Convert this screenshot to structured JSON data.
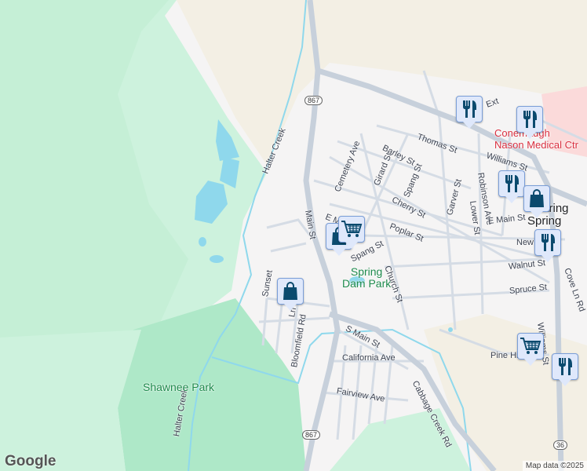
{
  "map": {
    "streets": [
      "Main St",
      "E Main St",
      "Poplar St",
      "Spang St",
      "Church St",
      "Cemetery Ave",
      "Girard St",
      "Spang St",
      "Barley St",
      "Thomas St",
      "Cherry St",
      "Garver St",
      "Lower St",
      "Robinson Ave",
      "Williams St",
      "E Main St",
      "New St",
      "Walnut St",
      "Spruce St",
      "Williams St",
      "Cove Ln Rd",
      "S Main St",
      "California Ave",
      "Fairview Ave",
      "Bloomfield Rd",
      "Cabbage Creek Rd",
      "Pine Hill St",
      "Halter Creek",
      "Halter Creek",
      "Sunset",
      "Ln",
      "Ext"
    ],
    "places": {
      "park1": "Spring\nDam Park",
      "park2": "Shawnee Park",
      "hospital": "Conemaugh\nNason Medical Ctr",
      "town": "Roaring\nSpring"
    },
    "route_shields": [
      "867",
      "867",
      "36"
    ],
    "markers": [
      {
        "type": "restaurant",
        "icon": "fork-knife-icon"
      },
      {
        "type": "restaurant",
        "icon": "fork-knife-icon"
      },
      {
        "type": "restaurant",
        "icon": "fork-knife-icon"
      },
      {
        "type": "restaurant",
        "icon": "fork-knife-icon"
      },
      {
        "type": "restaurant",
        "icon": "fork-knife-icon"
      },
      {
        "type": "shopping",
        "icon": "shopping-bag-icon"
      },
      {
        "type": "shopping",
        "icon": "shopping-bag-icon"
      },
      {
        "type": "shopping",
        "icon": "shopping-bag-icon"
      },
      {
        "type": "grocery",
        "icon": "shopping-cart-icon"
      },
      {
        "type": "grocery",
        "icon": "shopping-cart-icon"
      }
    ],
    "logo": "Google",
    "attribution": "Map data ©2025",
    "colors": {
      "land": "#f5f4f4",
      "park": "#cdf2dd",
      "forest": "#a9e6c6",
      "water": "#8fd8ec",
      "urban": "#f3efe4",
      "hospital": "#fbdada",
      "road": "#d5dce5",
      "marker": "#0b4a6e"
    }
  }
}
